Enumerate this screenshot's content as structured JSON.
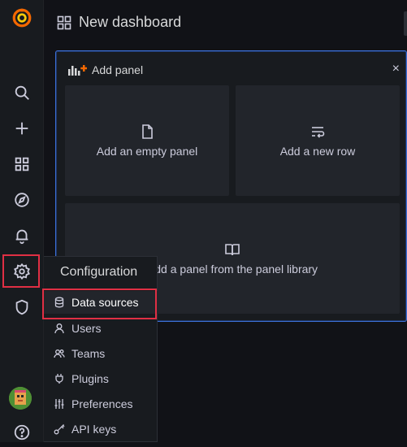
{
  "app": {
    "brand_color": "#f46800",
    "accent_color": "#3d71d9",
    "highlight_color": "#e02f44"
  },
  "sidebar": {
    "items": [
      {
        "name": "search",
        "icon": "search-icon"
      },
      {
        "name": "create",
        "icon": "plus-icon"
      },
      {
        "name": "dashboards",
        "icon": "apps-icon"
      },
      {
        "name": "explore",
        "icon": "compass-icon"
      },
      {
        "name": "alerting",
        "icon": "bell-icon"
      },
      {
        "name": "configuration",
        "icon": "cog-icon",
        "highlighted": true
      },
      {
        "name": "server-admin",
        "icon": "shield-icon"
      }
    ],
    "bottom": [
      {
        "name": "profile",
        "icon": "avatar"
      },
      {
        "name": "help",
        "icon": "question-circle-icon"
      }
    ]
  },
  "header": {
    "title": "New dashboard"
  },
  "add_panel": {
    "title": "Add panel",
    "close": "×",
    "tiles": [
      {
        "label": "Add an empty panel",
        "icon": "file-blank-icon"
      },
      {
        "label": "Add a new row",
        "icon": "wrap-text-icon"
      },
      {
        "label": "Add a panel from the panel library",
        "icon": "book-open-icon"
      }
    ]
  },
  "config_menu": {
    "header": "Configuration",
    "items": [
      {
        "label": "Data sources",
        "icon": "database-icon",
        "active": true
      },
      {
        "label": "Users",
        "icon": "user-icon"
      },
      {
        "label": "Teams",
        "icon": "users-alt-icon"
      },
      {
        "label": "Plugins",
        "icon": "plug-icon"
      },
      {
        "label": "Preferences",
        "icon": "sliders-icon"
      },
      {
        "label": "API keys",
        "icon": "key-icon"
      }
    ]
  }
}
